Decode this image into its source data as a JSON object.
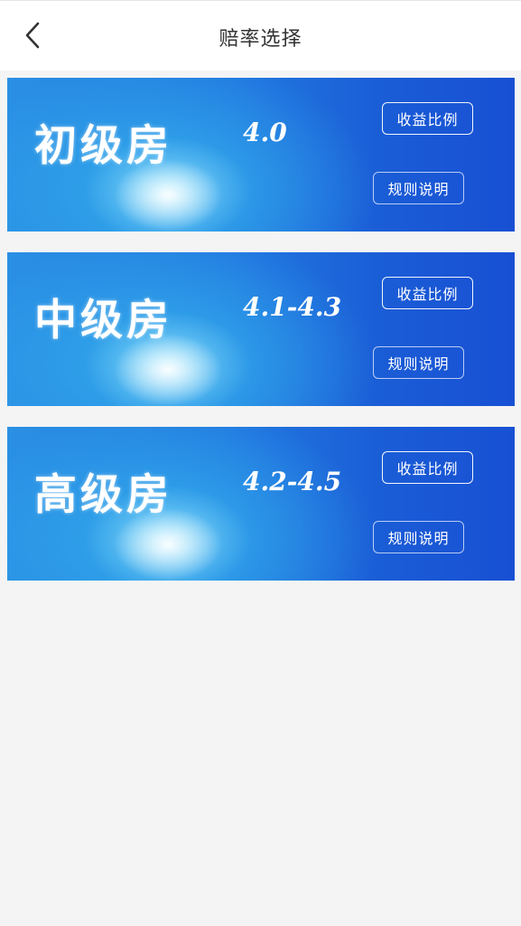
{
  "header": {
    "title": "赔率选择",
    "back_icon": "chevron-left-icon"
  },
  "rooms": [
    {
      "name": "初级房",
      "rate": "4.0",
      "ratio_label": "收益比例",
      "rules_label": "规则说明"
    },
    {
      "name": "中级房",
      "rate": "4.1-4.3",
      "ratio_label": "收益比例",
      "rules_label": "规则说明"
    },
    {
      "name": "高级房",
      "rate": "4.2-4.5",
      "ratio_label": "收益比例",
      "rules_label": "规则说明"
    }
  ],
  "colors": {
    "background": "#f4f4f4",
    "header_bg": "#ffffff",
    "card_left": "#2a90e4",
    "card_right": "#1850d4",
    "card_glow": "#96ebff"
  }
}
